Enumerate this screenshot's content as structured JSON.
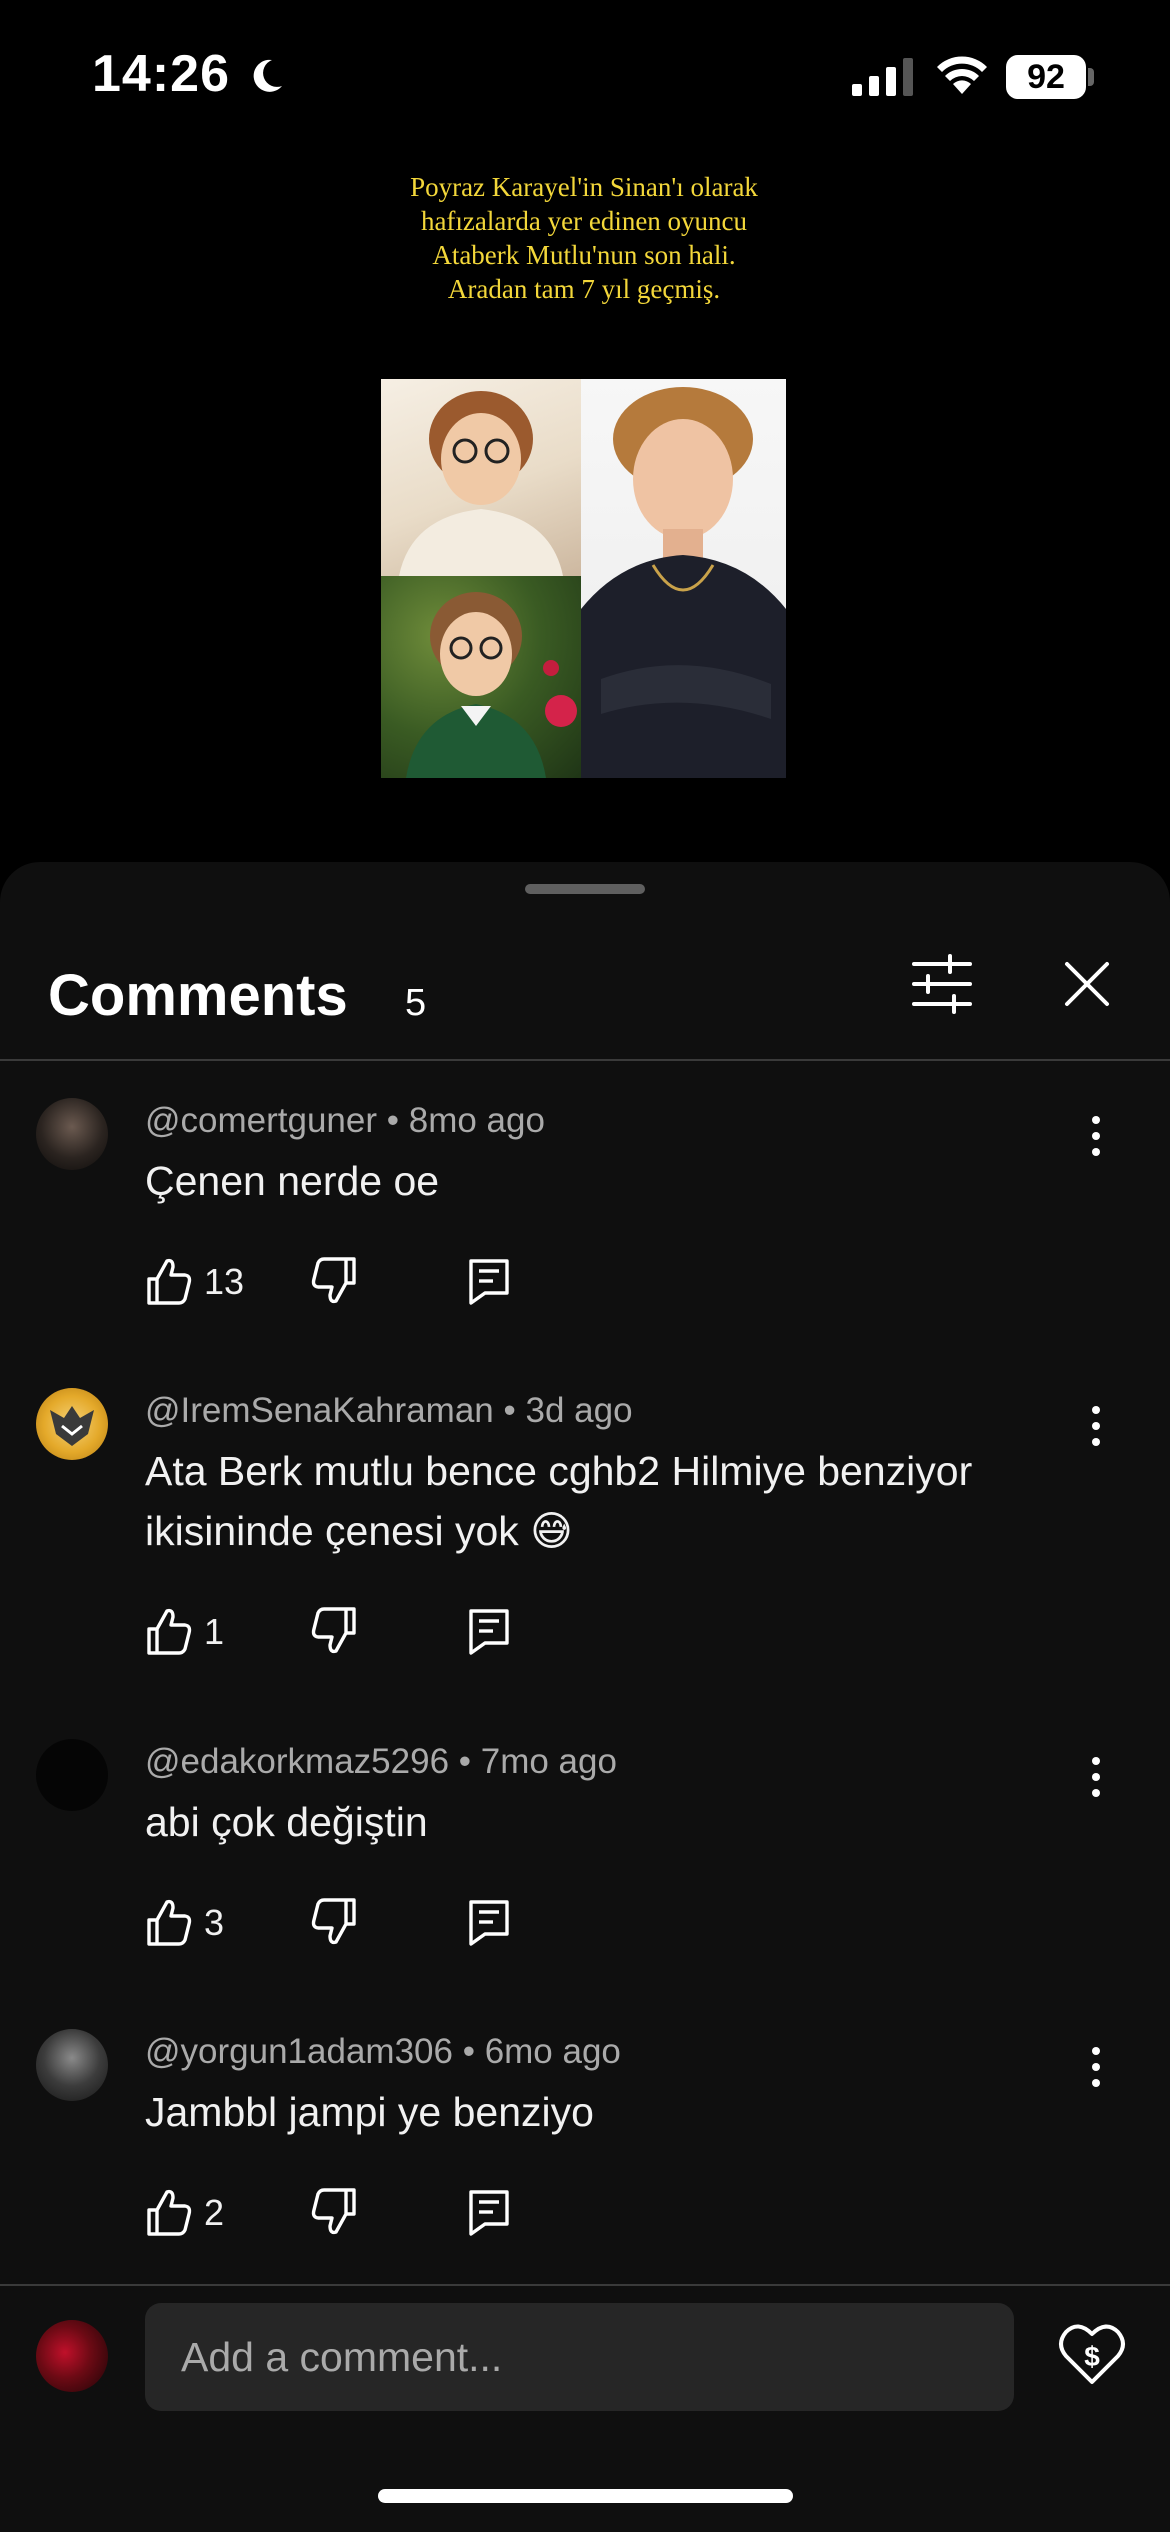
{
  "status_bar": {
    "time": "14:26",
    "battery_level": "92"
  },
  "video": {
    "caption": "Poyraz Karayel'in Sinan'ı olarak hafızalarda yer edinen oyuncu Ataberk Mutlu'nun son hali. Aradan tam 7 yıl geçmiş."
  },
  "comments_panel": {
    "title": "Comments",
    "count": "5"
  },
  "comments": [
    {
      "author": "@comertguner",
      "time": "8mo ago",
      "text": "Çenen nerde oe",
      "likes": "13"
    },
    {
      "author": "@IremSenaKahraman",
      "time": "3d ago",
      "text": "Ata Berk mutlu bence cghb2 Hilmiye benziyor ikisininde çenesi yok 😅",
      "likes": "1"
    },
    {
      "author": "@edakorkmaz5296",
      "time": "7mo ago",
      "text": "abi çok değiştin",
      "likes": "3"
    },
    {
      "author": "@yorgun1adam306",
      "time": "6mo ago",
      "text": "Jambbl jampi ye benziyo",
      "likes": "2"
    }
  ],
  "composer": {
    "placeholder": "Add a comment..."
  },
  "colors": {
    "sheet_background": "#0f0f0f",
    "input_background": "#262626",
    "secondary_text": "#aaaaaa",
    "caption_yellow": "#f3d73a"
  },
  "icons": [
    "moon-icon",
    "signal-icon",
    "wifi-icon",
    "filter-icon",
    "close-icon",
    "more-vert-icon",
    "thumbs-up-icon",
    "thumbs-down-icon",
    "reply-icon",
    "thanks-heart-icon"
  ]
}
